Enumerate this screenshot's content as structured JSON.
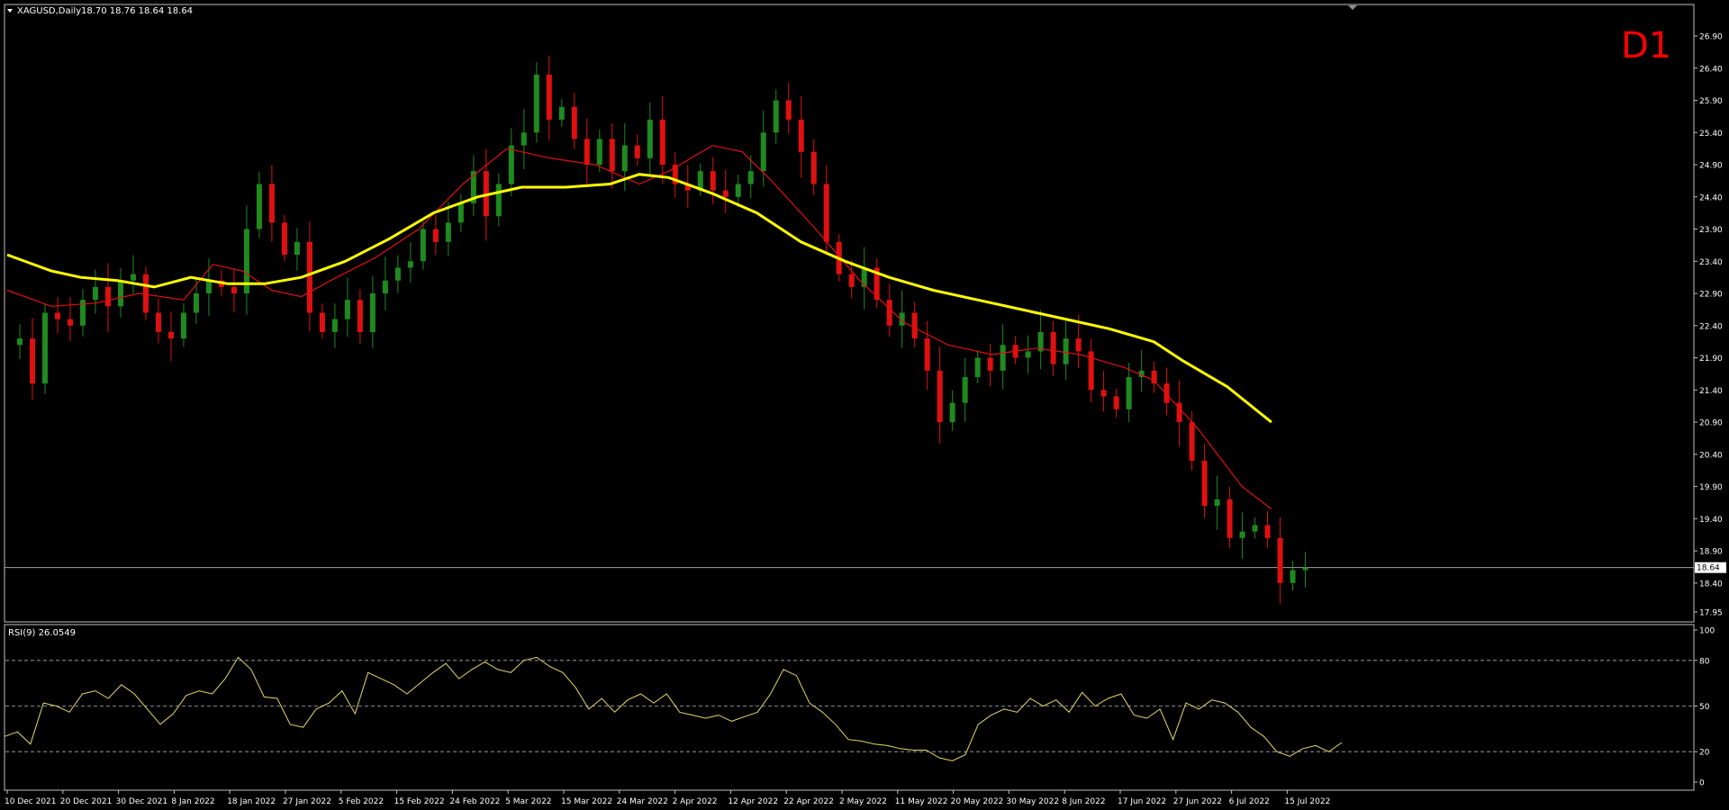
{
  "chart_data": {
    "type": "candlestick",
    "symbol": "XAGUSD,Daily",
    "ohlc_header": "18.70 18.76 18.64 18.64",
    "timeframe_label": "D1",
    "current_price_label": "18.64",
    "current_price": 18.64,
    "colors": {
      "background": "#000000",
      "bull": "#1f8a1f",
      "bear": "#e01010",
      "ma_slow": "#ffff00",
      "ma_fast": "#e01010",
      "rsi": "#e6d86a",
      "axis_text": "#ffffff",
      "frame": "#c0c0c0",
      "timeframe": "#ff0000"
    },
    "price_axis": {
      "ylim": [
        17.95,
        26.9
      ],
      "ticks": [
        "26.90",
        "26.40",
        "25.90",
        "25.40",
        "24.90",
        "24.40",
        "23.90",
        "23.40",
        "22.90",
        "22.40",
        "21.90",
        "21.40",
        "20.90",
        "20.40",
        "19.90",
        "19.40",
        "18.90",
        "18.40",
        "17.95"
      ]
    },
    "x_axis": {
      "ticks": [
        "10 Dec 2021",
        "20 Dec 2021",
        "30 Dec 2021",
        "8 Jan 2022",
        "18 Jan 2022",
        "27 Jan 2022",
        "5 Feb 2022",
        "15 Feb 2022",
        "24 Feb 2022",
        "5 Mar 2022",
        "15 Mar 2022",
        "24 Mar 2022",
        "2 Apr 2022",
        "12 Apr 2022",
        "22 Apr 2022",
        "2 May 2022",
        "11 May 2022",
        "20 May 2022",
        "30 May 2022",
        "8 Jun 2022",
        "17 Jun 2022",
        "27 Jun 2022",
        "6 Jul 2022",
        "15 Jul 2022"
      ]
    },
    "close_path": [
      22.1,
      22.2,
      21.5,
      22.6,
      22.5,
      22.4,
      22.8,
      23.0,
      22.7,
      23.1,
      23.2,
      22.6,
      22.3,
      22.2,
      22.6,
      22.9,
      23.1,
      23.0,
      22.9,
      23.9,
      24.6,
      24.0,
      23.5,
      23.7,
      22.6,
      22.3,
      22.5,
      22.8,
      22.3,
      22.9,
      23.1,
      23.3,
      23.4,
      23.9,
      23.7,
      24.0,
      24.3,
      24.8,
      24.1,
      24.6,
      25.2,
      25.4,
      26.3,
      25.6,
      25.8,
      25.3,
      24.9,
      25.3,
      24.8,
      25.2,
      25.0,
      25.6,
      24.9,
      24.6,
      24.5,
      24.8,
      24.5,
      24.4,
      24.6,
      24.8,
      25.4,
      25.9,
      25.6,
      25.1,
      24.6,
      23.7,
      23.2,
      23.0,
      23.3,
      22.8,
      22.4,
      22.6,
      22.2,
      21.7,
      20.9,
      21.2,
      21.6,
      21.9,
      21.7,
      22.1,
      21.9,
      22.0,
      22.3,
      21.8,
      22.2,
      22.0,
      21.4,
      21.3,
      21.1,
      21.6,
      21.7,
      21.5,
      21.2,
      20.9,
      20.3,
      19.6,
      19.7,
      19.1,
      19.2,
      19.3,
      19.1,
      18.4,
      18.6,
      18.64
    ],
    "ma_slow": {
      "name": "",
      "points": [
        [
          0,
          23.5
        ],
        [
          6,
          23.25
        ],
        [
          10,
          23.15
        ],
        [
          15,
          23.1
        ],
        [
          20,
          23.0
        ],
        [
          25,
          23.15
        ],
        [
          30,
          23.05
        ],
        [
          35,
          23.05
        ],
        [
          40,
          23.15
        ],
        [
          46,
          23.4
        ],
        [
          52,
          23.75
        ],
        [
          58,
          24.15
        ],
        [
          64,
          24.4
        ],
        [
          70,
          24.55
        ],
        [
          76,
          24.55
        ],
        [
          82,
          24.6
        ],
        [
          86,
          24.75
        ],
        [
          90,
          24.7
        ],
        [
          96,
          24.45
        ],
        [
          102,
          24.15
        ],
        [
          108,
          23.7
        ],
        [
          114,
          23.4
        ],
        [
          120,
          23.15
        ],
        [
          126,
          22.95
        ],
        [
          132,
          22.8
        ],
        [
          138,
          22.65
        ],
        [
          144,
          22.5
        ],
        [
          150,
          22.35
        ],
        [
          156,
          22.15
        ],
        [
          160,
          21.85
        ],
        [
          166,
          21.45
        ],
        [
          172,
          20.9
        ]
      ]
    },
    "ma_fast": {
      "name": "",
      "points": [
        [
          0,
          22.95
        ],
        [
          6,
          22.7
        ],
        [
          12,
          22.75
        ],
        [
          18,
          22.9
        ],
        [
          24,
          22.8
        ],
        [
          28,
          23.35
        ],
        [
          32,
          23.25
        ],
        [
          36,
          22.95
        ],
        [
          40,
          22.85
        ],
        [
          44,
          23.1
        ],
        [
          50,
          23.45
        ],
        [
          56,
          23.9
        ],
        [
          62,
          24.6
        ],
        [
          68,
          25.15
        ],
        [
          74,
          25.0
        ],
        [
          80,
          24.9
        ],
        [
          86,
          24.6
        ],
        [
          90,
          24.8
        ],
        [
          96,
          25.2
        ],
        [
          100,
          25.1
        ],
        [
          104,
          24.65
        ],
        [
          110,
          23.9
        ],
        [
          116,
          23.1
        ],
        [
          122,
          22.45
        ],
        [
          128,
          22.1
        ],
        [
          134,
          21.95
        ],
        [
          140,
          22.05
        ],
        [
          146,
          21.95
        ],
        [
          152,
          21.75
        ],
        [
          156,
          21.55
        ],
        [
          162,
          20.8
        ],
        [
          168,
          19.9
        ],
        [
          172,
          19.55
        ]
      ]
    },
    "rsi": {
      "label": "RSI(9) 26.0549",
      "period": 9,
      "last_value": 26.0549,
      "ylim": [
        0,
        100
      ],
      "ticks": [
        "100",
        "80",
        "50",
        "20",
        "0"
      ],
      "levels": [
        80,
        50,
        20
      ],
      "values": [
        30,
        33,
        25,
        52,
        50,
        46,
        58,
        60,
        55,
        64,
        58,
        48,
        38,
        45,
        57,
        60,
        58,
        68,
        82,
        74,
        56,
        55,
        38,
        36,
        48,
        52,
        60,
        45,
        72,
        68,
        64,
        58,
        65,
        72,
        78,
        68,
        74,
        79,
        74,
        72,
        80,
        82,
        76,
        72,
        62,
        48,
        55,
        46,
        54,
        58,
        52,
        58,
        46,
        44,
        42,
        44,
        40,
        43,
        46,
        58,
        74,
        70,
        52,
        46,
        38,
        28,
        27,
        25,
        24,
        22,
        21,
        21,
        16,
        14,
        18,
        38,
        44,
        48,
        46,
        55,
        50,
        54,
        46,
        59,
        50,
        55,
        58,
        44,
        42,
        48,
        28,
        52,
        48,
        54,
        52,
        46,
        36,
        30,
        20,
        17,
        22,
        24,
        20,
        26
      ]
    }
  }
}
